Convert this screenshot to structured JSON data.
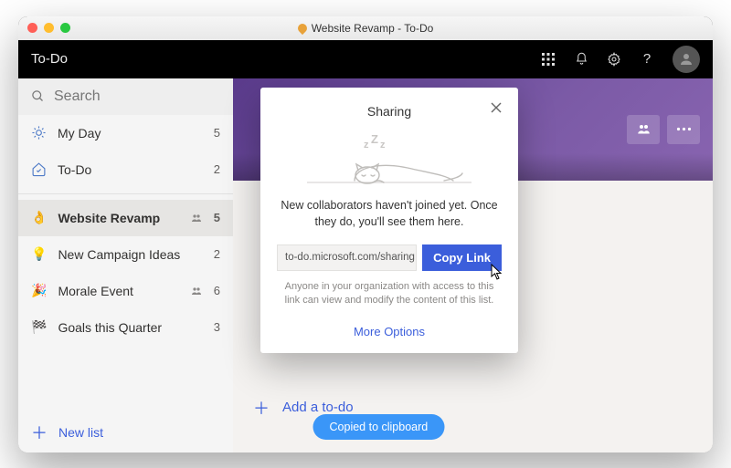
{
  "window": {
    "title": "Website Revamp - To-Do"
  },
  "topbar": {
    "app_name": "To-Do"
  },
  "search": {
    "placeholder": "Search"
  },
  "sidebar": {
    "smart": [
      {
        "icon": "sun",
        "label": "My Day",
        "count": 5
      },
      {
        "icon": "home",
        "label": "To-Do",
        "count": 2
      }
    ],
    "lists": [
      {
        "icon": "emoji-like",
        "label": "Website Revamp",
        "count": 5,
        "shared": true,
        "selected": true
      },
      {
        "icon": "bulb",
        "label": "New Campaign Ideas",
        "count": 2,
        "shared": false
      },
      {
        "icon": "popper",
        "label": "Morale Event",
        "count": 6,
        "shared": true
      },
      {
        "icon": "flag",
        "label": "Goals this Quarter",
        "count": 3,
        "shared": false
      }
    ],
    "new_list_label": "New list"
  },
  "main": {
    "add_todo_label": "Add a to-do"
  },
  "modal": {
    "title": "Sharing",
    "message": "New collaborators haven't joined yet. Once they do, you'll see them here.",
    "link_value": "to-do.microsoft.com/sharing",
    "copy_label": "Copy Link",
    "disclaimer": "Anyone in your organization with access to this link can view and modify the content of this list.",
    "more_options": "More Options"
  },
  "toast": {
    "text": "Copied to clipboard"
  }
}
